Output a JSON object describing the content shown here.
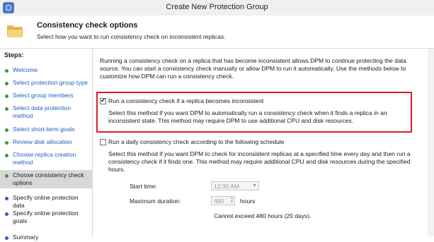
{
  "window": {
    "title": "Create New Protection Group"
  },
  "header": {
    "title": "Consistency check options",
    "subtitle": "Select how you want to run consistency check on inconsistent replicas."
  },
  "sidebar": {
    "label": "Steps:",
    "items": [
      {
        "label": "Welcome"
      },
      {
        "label": "Select protection group type"
      },
      {
        "label": "Select group members"
      },
      {
        "label": "Select data protection method"
      },
      {
        "label": "Select short-term goals"
      },
      {
        "label": "Review disk allocation"
      },
      {
        "label": "Choose replica creation method"
      },
      {
        "label": "Choose consistency check options"
      },
      {
        "label": "Specify online protection data"
      },
      {
        "label": "Specify online protection goals"
      },
      {
        "label": "Summary"
      }
    ]
  },
  "main": {
    "intro": "Running a consistency check on a replica that has become inconsistent allows DPM to continue protecting the data source. You can start a consistency check manually or allow DPM to run it automatically. Use the methods below to customize how DPM can run a consistency check.",
    "option1": {
      "label": "Run a consistency check if a replica becomes inconsistent",
      "checked": true,
      "description": "Select this method if you want DPM to automatically run a consistency check when it finds a replica in an inconsistent state. This method may require DPM to use additional CPU and disk resources."
    },
    "option2": {
      "label": "Run a daily consistency check according to the following schedule",
      "checked": false,
      "description": "Select this method if you want DPM to check for inconsistent replicas at a specified time every day and then run a consistency check if it finds one. This method may require additional CPU and disk resources during the specified hours."
    },
    "start_time": {
      "label": "Start time:",
      "value": "12:00 AM"
    },
    "max_duration": {
      "label": "Maximum duration:",
      "value": "480",
      "unit": "hours"
    },
    "note": "Cannot exceed 480 hours (20 days)."
  }
}
